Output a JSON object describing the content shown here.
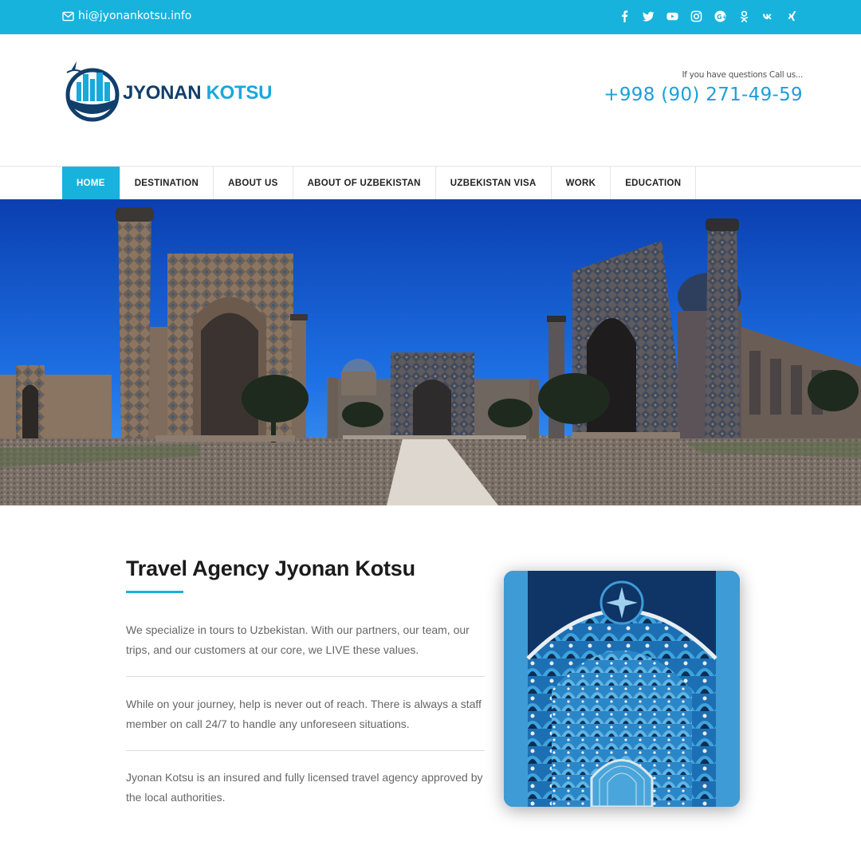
{
  "topbar": {
    "email": "hi@jyonankotsu.info",
    "email_icon": "envelope-icon",
    "social_icons": [
      "facebook-icon",
      "twitter-icon",
      "youtube-icon",
      "instagram-icon",
      "google-plus-icon",
      "odnoklassniki-icon",
      "vk-icon",
      "xing-icon"
    ]
  },
  "header": {
    "brand_part1": "JYONAN",
    "brand_part2": "KOTSU",
    "question": "If you have questions Call us...",
    "phone": "+998 (90) 271-49-59"
  },
  "nav": {
    "items": [
      {
        "label": "HOME"
      },
      {
        "label": "DESTINATION"
      },
      {
        "label": "ABOUT US"
      },
      {
        "label": "ABOUT OF UZBEKISTAN"
      },
      {
        "label": "UZBEKISTAN VISA"
      },
      {
        "label": "WORK"
      },
      {
        "label": "EDUCATION"
      }
    ]
  },
  "content": {
    "title": "Travel Agency Jyonan Kotsu",
    "paragraphs": [
      "We specialize in tours to Uzbekistan. With our partners, our team, our trips, and our customers at our core, we LIVE these values.",
      "While on your journey, help is never out of reach. There is always a staff member on call 24/7 to handle any unforeseen situations.",
      "Jyonan Kotsu is an insured and fully licensed travel agency approved by the local authorities."
    ]
  },
  "colors": {
    "accent": "#17b3dd",
    "brand_dark": "#123e6b",
    "phone": "#1aa0d8"
  }
}
